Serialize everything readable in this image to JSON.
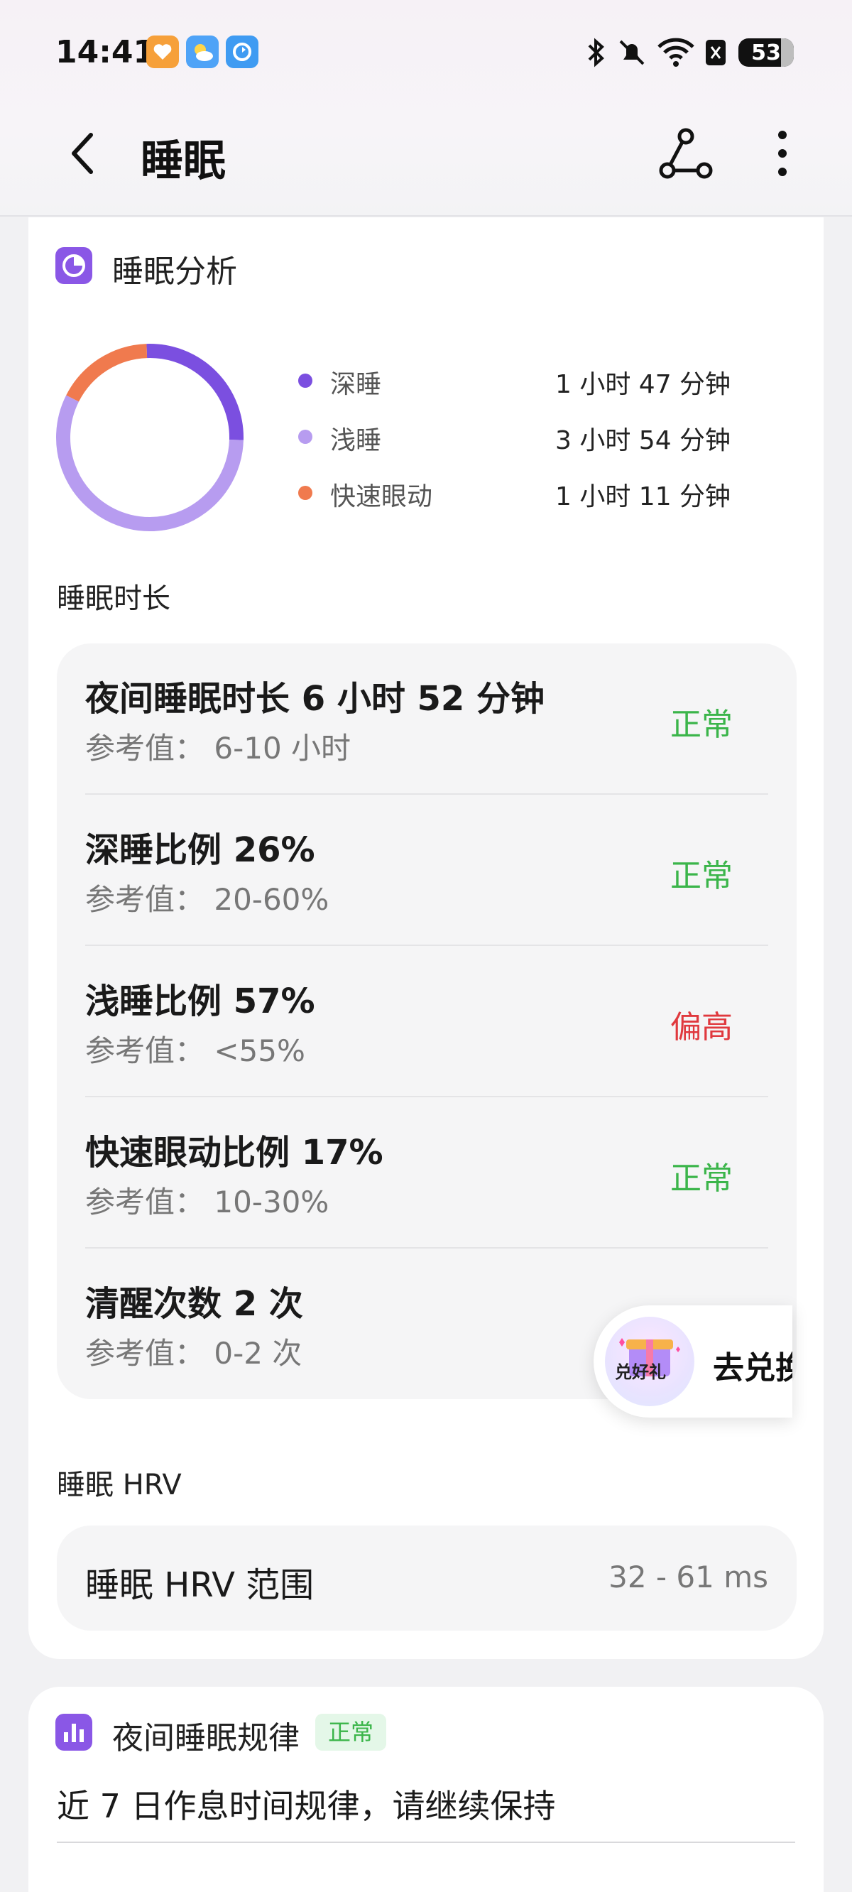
{
  "status_bar": {
    "time": "14:41",
    "battery": "53",
    "app_icons": [
      "heart-app-icon",
      "weather-app-icon",
      "sync-app-icon"
    ],
    "system_icons": [
      "bluetooth-icon",
      "mute-icon",
      "wifi-icon",
      "sim-off-icon"
    ]
  },
  "header": {
    "title": "睡眠",
    "back_icon": "chevron-left-icon",
    "share_icon": "share-nodes-icon",
    "more_icon": "more-vertical-icon"
  },
  "analysis": {
    "title": "睡眠分析",
    "legend": [
      {
        "label": "深睡",
        "value": "1 小时 47 分钟",
        "color": "#7b4fe0",
        "fraction": 0.26
      },
      {
        "label": "浅睡",
        "value": "3 小时 54 分钟",
        "color": "#b79cf0",
        "fraction": 0.57
      },
      {
        "label": "快速眼动",
        "value": "1 小时 11 分钟",
        "color": "#f07a4e",
        "fraction": 0.17
      }
    ],
    "duration_heading": "睡眠时长",
    "metrics": [
      {
        "title": "夜间睡眠时长 6 小时 52 分钟",
        "ref": "参考值： 6-10 小时",
        "status": "正常",
        "status_color": "#3bb54a"
      },
      {
        "title": "深睡比例 26%",
        "ref": "参考值： 20-60%",
        "status": "正常",
        "status_color": "#3bb54a"
      },
      {
        "title": "浅睡比例 57%",
        "ref": "参考值： <55%",
        "status": "偏高",
        "status_color": "#e0393e"
      },
      {
        "title": "快速眼动比例 17%",
        "ref": "参考值： 10-30%",
        "status": "正常",
        "status_color": "#3bb54a"
      },
      {
        "title": "清醒次数 2 次",
        "ref": "参考值： 0-2 次",
        "status": "",
        "status_color": "#3bb54a"
      }
    ],
    "hrv_heading": "睡眠 HRV",
    "hrv_label": "睡眠 HRV 范围",
    "hrv_value": "32 - 61 ms"
  },
  "floating_promo": {
    "gift_text": "兑好礼",
    "action": "去兑换"
  },
  "regularity": {
    "title": "夜间睡眠规律",
    "badge": "正常",
    "description": "近 7 日作息时间规律，请继续保持"
  }
}
